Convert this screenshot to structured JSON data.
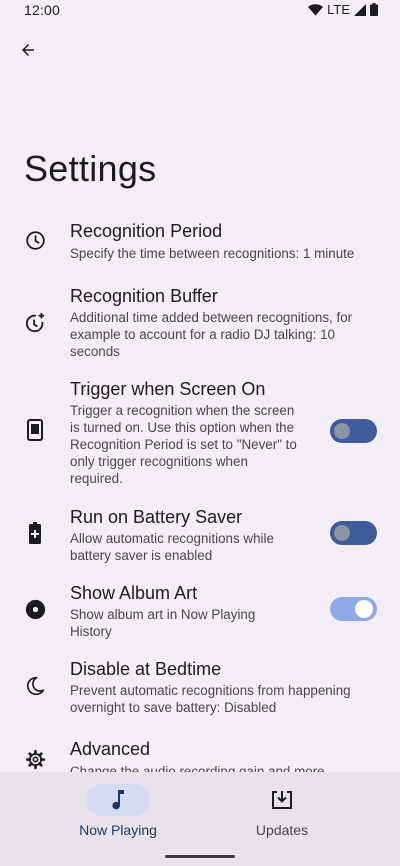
{
  "status_bar": {
    "time": "12:00",
    "network": "LTE"
  },
  "header": {
    "title": "Settings"
  },
  "settings": [
    {
      "title": "Recognition Period",
      "subtitle": "Specify the time between recognitions: 1 minute"
    },
    {
      "title": "Recognition Buffer",
      "subtitle": "Additional time added between recognitions, for example to account for a radio DJ talking: 10 seconds"
    },
    {
      "title": "Trigger when Screen On",
      "subtitle": "Trigger a recognition when the screen is turned on. Use this option when the Recognition Period is set to \"Never\" to only trigger recognitions when required.",
      "toggle": false
    },
    {
      "title": "Run on Battery Saver",
      "subtitle": "Allow automatic recognitions while battery saver is enabled",
      "toggle": false
    },
    {
      "title": "Show Album Art",
      "subtitle": "Show album art in Now Playing History",
      "toggle": true
    },
    {
      "title": "Disable at Bedtime",
      "subtitle": "Prevent automatic recognitions from happening overnight to save battery: Disabled"
    },
    {
      "title": "Advanced",
      "subtitle": "Change the audio recording gain and more"
    }
  ],
  "bottom_nav": {
    "tabs": [
      {
        "label": "Now Playing",
        "icon": "music-note-icon",
        "active": true
      },
      {
        "label": "Updates",
        "icon": "download-box-icon",
        "active": false
      }
    ]
  },
  "colors": {
    "background": "#f3eef5",
    "toggle_off_track": "#3f5b99",
    "toggle_on_track": "#8fa8e8",
    "nav_active_pill": "#d4dbf3",
    "nav_background": "#e8e3ea"
  }
}
